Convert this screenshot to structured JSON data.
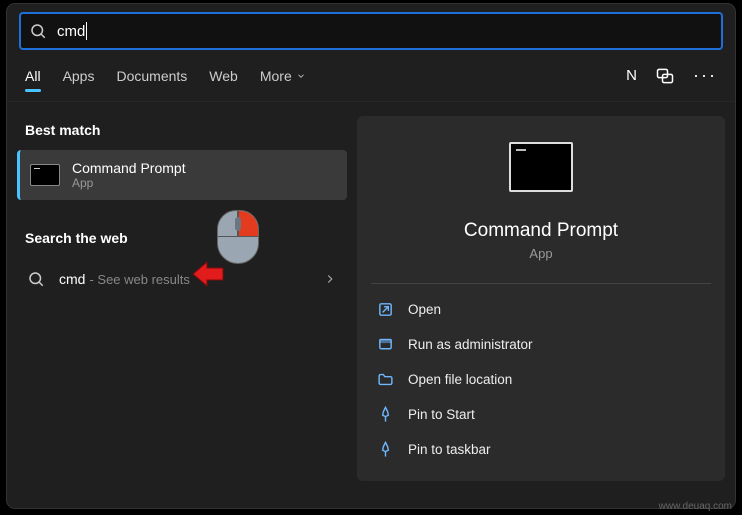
{
  "search": {
    "query": "cmd"
  },
  "tabs": {
    "items": [
      "All",
      "Apps",
      "Documents",
      "Web",
      "More"
    ],
    "active_index": 0
  },
  "top_right": {
    "letter": "N"
  },
  "left": {
    "best_match_label": "Best match",
    "best_match": {
      "title": "Command Prompt",
      "subtitle": "App"
    },
    "search_web_label": "Search the web",
    "web_item": {
      "term": "cmd",
      "suffix": "- See web results"
    }
  },
  "right": {
    "title": "Command Prompt",
    "subtitle": "App",
    "actions": [
      {
        "icon": "open",
        "label": "Open"
      },
      {
        "icon": "admin",
        "label": "Run as administrator"
      },
      {
        "icon": "folder",
        "label": "Open file location"
      },
      {
        "icon": "pin",
        "label": "Pin to Start"
      },
      {
        "icon": "pin",
        "label": "Pin to taskbar"
      }
    ]
  },
  "watermark": "www.deuaq.com"
}
